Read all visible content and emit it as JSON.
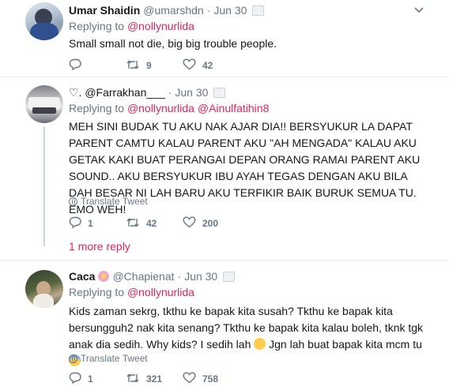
{
  "tweets": [
    {
      "name": "Umar Shaidin",
      "handle": "@umarshdn",
      "dot": "·",
      "time": "Jun 30",
      "replying_prefix": "Replying to ",
      "replying_to": [
        "@nollynurlida"
      ],
      "text": "Small small not die, big big trouble people.",
      "counts": {
        "reply": "",
        "retweet": "9",
        "like": "42"
      }
    },
    {
      "name": "♡. @Farrakhan___",
      "dot": "·",
      "time": "Jun 30",
      "replying_prefix": "Replying to ",
      "replying_to": [
        "@nollynurlida",
        "@Ainulfatihin8"
      ],
      "text": "MEH SINI BUDAK TU AKU NAK AJAR DIA!! BERSYUKUR LA DAPAT PARENT CAMTU KALAU PARENT AKU \"AH MENGADA\" KALAU AKU GETAK KAKI BUAT PERANGAI DEPAN ORANG RAMAI PARENT AKU SOUND.. AKU BERSYUKUR IBU AYAH TEGAS DENGAN AKU BILA DAH BESAR NI LAH BARU AKU TERFIKIR BAIK BURUK SEMUA TU. EMO WEH!",
      "translate": "Translate Tweet",
      "counts": {
        "reply": "1",
        "retweet": "42",
        "like": "200"
      },
      "more_replies": "1 more reply"
    },
    {
      "name": "Caca",
      "handle": "@Chapienat",
      "dot": "·",
      "time": "Jun 30",
      "replying_prefix": "Replying to ",
      "replying_to": [
        "@nollynurlida"
      ],
      "text_part1": "Kids zaman sekrg, tkthu ke bapak kita susah? Tkthu ke bapak kita bersungguh2 nak kita senang? Tkthu ke bapak kita kalau boleh, tknk tgk anak dia sedih. Why kids? I sedih lah ",
      "text_part2": " Jgn lah buat bapak kita mcm tu ",
      "translate": "Translate Tweet",
      "counts": {
        "reply": "1",
        "retweet": "321",
        "like": "758"
      }
    }
  ],
  "icons": [
    "reply-icon",
    "retweet-icon",
    "like-icon",
    "caret-down-icon",
    "globe-icon",
    "message-icon"
  ],
  "colors": {
    "accent": "#e0245e",
    "muted": "#657786",
    "divider": "#e6ecf0"
  }
}
